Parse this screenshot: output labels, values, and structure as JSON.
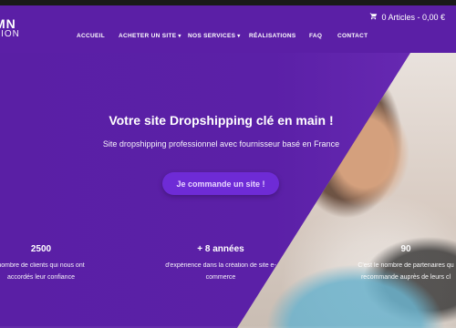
{
  "header": {
    "logo_line1": "MN",
    "logo_line2": "TION",
    "cart_text": "0 Articles - 0,00 €",
    "nav": [
      {
        "label": "ACCUEIL"
      },
      {
        "label": "ACHETER UN SITE",
        "has_dropdown": true
      },
      {
        "label": "NOS SERVICES",
        "has_dropdown": true
      },
      {
        "label": "RÉALISATIONS"
      },
      {
        "label": "FAQ"
      },
      {
        "label": "CONTACT"
      }
    ]
  },
  "hero": {
    "title": "Votre site Dropshipping clé en main !",
    "subtitle": "Site dropshipping professionnel avec fournisseur basé en France",
    "cta_label": "Je commande un site !"
  },
  "stats": [
    {
      "value": "2500",
      "desc_line1": "nombre de clients qui nous ont",
      "desc_line2": "accordés leur confiance"
    },
    {
      "value": "+ 8 années",
      "desc_line1": "d'expérience dans la création de site e-",
      "desc_line2": "commerce"
    },
    {
      "value": "90",
      "desc_line1": "C'est le nombre de partenaires qu",
      "desc_line2": "recommande auprès de leurs cl"
    }
  ],
  "colors": {
    "background": "#5b1fa6",
    "cta_background": "#6e2bd6",
    "topbar": "#1a1a1a"
  },
  "icons": {
    "cart": "cart-icon",
    "nav_dropdown": "chevron-down-icon"
  }
}
